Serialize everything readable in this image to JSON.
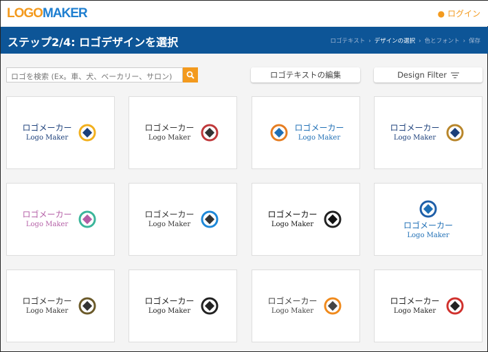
{
  "header": {
    "logo_part1": "LOGO",
    "logo_part2": "MAKER",
    "login": "ログイン"
  },
  "step": {
    "title": "ステップ2/4: ロゴデザインを選択",
    "crumbs": [
      "ロゴテキスト",
      "デザインの選択",
      "色とフォント",
      "保存"
    ]
  },
  "toolbar": {
    "search_placeholder": "ロゴを検索 (Ex。車、犬、ベーカリー、サロン)",
    "edit_text": "ロゴテキストの編集",
    "design_filter": "Design Filter"
  },
  "cards": [
    {
      "jp": "ロゴメーカー",
      "en": "Logo Maker",
      "color": "#1b3f7a",
      "accent": "#f2b01e",
      "icon": "diamond-chain-icon"
    },
    {
      "jp": "ロゴメーカー",
      "en": "Logo Maker",
      "color": "#333333",
      "accent": "#c0393b",
      "icon": "heart-hands-icon"
    },
    {
      "jp": "ロゴメーカー",
      "en": "Logo Maker",
      "color": "#1f6fb5",
      "accent": "#e67e22",
      "icon": "people-circle-icon"
    },
    {
      "jp": "ロゴメーカー",
      "en": "Logo Maker",
      "color": "#1b3f7a",
      "accent": "#b8862b",
      "icon": "atlas-globe-icon"
    },
    {
      "jp": "ロゴメーカー",
      "en": "Logo Maker",
      "color": "#b45fa6",
      "accent": "#3bb59a",
      "icon": "lotus-woman-icon"
    },
    {
      "jp": "ロゴメーカー",
      "en": "Logo Maker",
      "color": "#333333",
      "accent": "#1e88d8",
      "icon": "city-skyline-icon"
    },
    {
      "jp": "ロゴメーカー",
      "en": "Logo Maker",
      "color": "#111111",
      "accent": "#222222",
      "icon": "gamer-badge-icon"
    },
    {
      "jp": "ロゴメーカー",
      "en": "Logo Maker",
      "color": "#1f6fb5",
      "accent": "#1f5fa8",
      "icon": "building-swoosh-icon"
    },
    {
      "jp": "ロゴメーカー",
      "en": "Logo Maker",
      "color": "#333333",
      "accent": "#6b5a2a",
      "icon": "camera-ornament-icon"
    },
    {
      "jp": "ロゴメーカー",
      "en": "Logo Maker",
      "color": "#222222",
      "accent": "#222222",
      "icon": "camera-film-icon"
    },
    {
      "jp": "ロゴメーカー",
      "en": "Logo Maker",
      "color": "#444444",
      "accent": "#f08a1c",
      "icon": "sun-swirl-icon"
    },
    {
      "jp": "ロゴメーカー",
      "en": "Logo Maker",
      "color": "#222222",
      "accent": "#d0312d",
      "icon": "mascot-character-icon"
    }
  ]
}
